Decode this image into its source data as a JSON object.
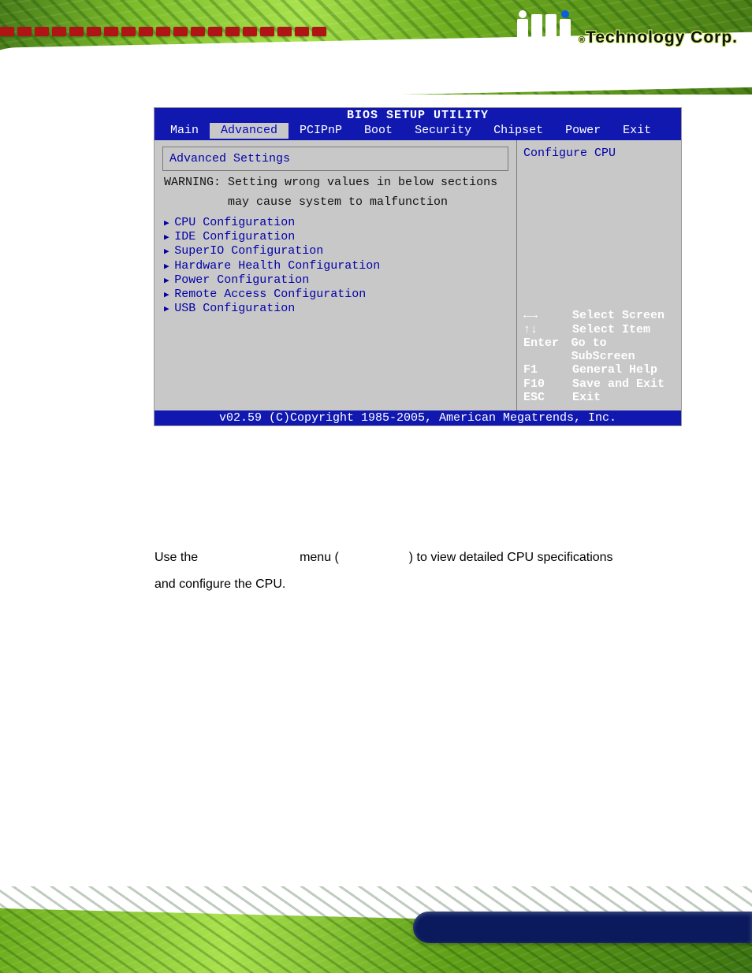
{
  "brand": {
    "registered_mark": "®",
    "company_text": "Technology Corp."
  },
  "bios": {
    "title": "BIOS SETUP UTILITY",
    "tabs": [
      "Main",
      "Advanced",
      "PCIPnP",
      "Boot",
      "Security",
      "Chipset",
      "Power",
      "Exit"
    ],
    "active_tab": "Advanced",
    "panel_heading": "Advanced Settings",
    "warning_line1": "WARNING: Setting wrong values in below sections",
    "warning_line2": "         may cause system to malfunction",
    "menu_items": [
      "CPU Configuration",
      "IDE Configuration",
      "SuperIO Configuration",
      "Hardware Health Configuration",
      "Power Configuration",
      "Remote Access Configuration",
      "USB Configuration"
    ],
    "help_text": "Configure CPU",
    "key_help": [
      {
        "key": "←→",
        "desc": "Select Screen"
      },
      {
        "key": "↑↓",
        "desc": "Select Item"
      },
      {
        "key": "Enter",
        "desc": "Go to SubScreen"
      },
      {
        "key": "F1",
        "desc": "General Help"
      },
      {
        "key": "F10",
        "desc": "Save and Exit"
      },
      {
        "key": "ESC",
        "desc": "Exit"
      }
    ],
    "footer": "v02.59 (C)Copyright 1985-2005, American Megatrends, Inc."
  },
  "paragraph": {
    "seg1": "Use the ",
    "seg2": " menu (",
    "seg3": ") to view detailed CPU specifications",
    "seg4": "and configure the CPU."
  }
}
